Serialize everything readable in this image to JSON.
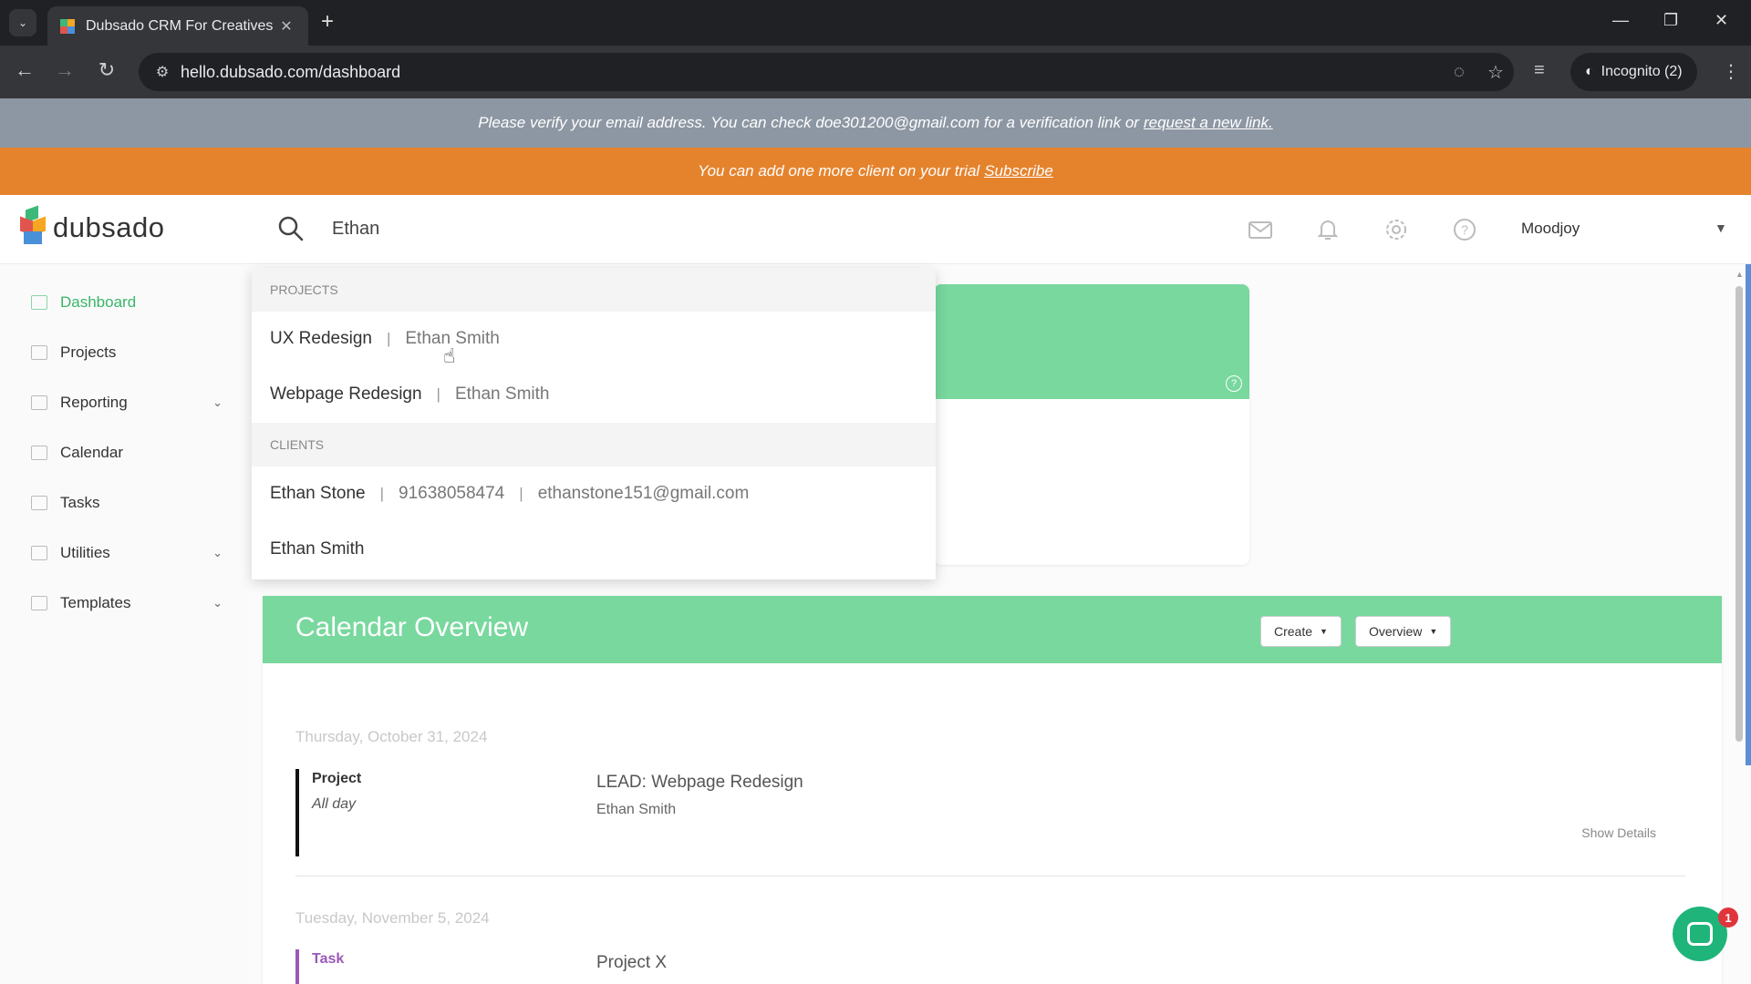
{
  "browser": {
    "tab_title": "Dubsado CRM For Creatives",
    "tab_close": "✕",
    "new_tab": "+",
    "url": "hello.dubsado.com/dashboard",
    "incognito_label": "Incognito (2)"
  },
  "banners": {
    "verify_text": "Please verify your email address. You can check doe301200@gmail.com for a verification link or",
    "verify_link": "request a new link.",
    "trial_text": "You can add one more client on your trial",
    "trial_link": "Subscribe"
  },
  "header": {
    "logo_text": "dubsado",
    "search_value": "Ethan",
    "user_name": "Moodjoy"
  },
  "sidebar": {
    "items": [
      {
        "label": "Dashboard",
        "icon": "dashboard-icon",
        "active": true
      },
      {
        "label": "Projects",
        "icon": "projects-icon"
      },
      {
        "label": "Reporting",
        "icon": "reporting-icon",
        "expandable": true
      },
      {
        "label": "Calendar",
        "icon": "calendar-icon"
      },
      {
        "label": "Tasks",
        "icon": "tasks-icon"
      },
      {
        "label": "Utilities",
        "icon": "utilities-icon",
        "expandable": true
      },
      {
        "label": "Templates",
        "icon": "templates-icon",
        "expandable": true
      }
    ]
  },
  "search_dropdown": {
    "projects_header": "PROJECTS",
    "projects": [
      {
        "name": "UX Redesign",
        "sep": "|",
        "client": "Ethan Smith"
      },
      {
        "name": "Webpage Redesign",
        "sep": "|",
        "client": "Ethan Smith"
      }
    ],
    "clients_header": "CLIENTS",
    "clients": [
      {
        "name": "Ethan Stone",
        "sep1": "|",
        "phone": "91638058474",
        "sep2": "|",
        "email": "ethanstone151@gmail.com"
      },
      {
        "name": "Ethan Smith"
      }
    ]
  },
  "calendar": {
    "title": "Calendar Overview",
    "create_label": "Create",
    "overview_label": "Overview",
    "days": [
      {
        "date": "Thursday, October 31, 2024",
        "event_type": "Project",
        "event_when": "All day",
        "event_title": "LEAD: Webpage Redesign",
        "event_client": "Ethan Smith",
        "details_label": "Show Details",
        "bar_color": "#111111"
      },
      {
        "date": "Tuesday, November 5, 2024",
        "event_type": "Task",
        "event_title": "Project X",
        "bar_color": "#9b59b6",
        "type_color": "#9b59b6"
      }
    ]
  },
  "chat": {
    "badge_count": "1"
  },
  "colors": {
    "accent_green": "#78d89e",
    "active_green": "#39b56a",
    "trial_orange": "#e5832d",
    "verify_gray": "#8d97a3"
  }
}
